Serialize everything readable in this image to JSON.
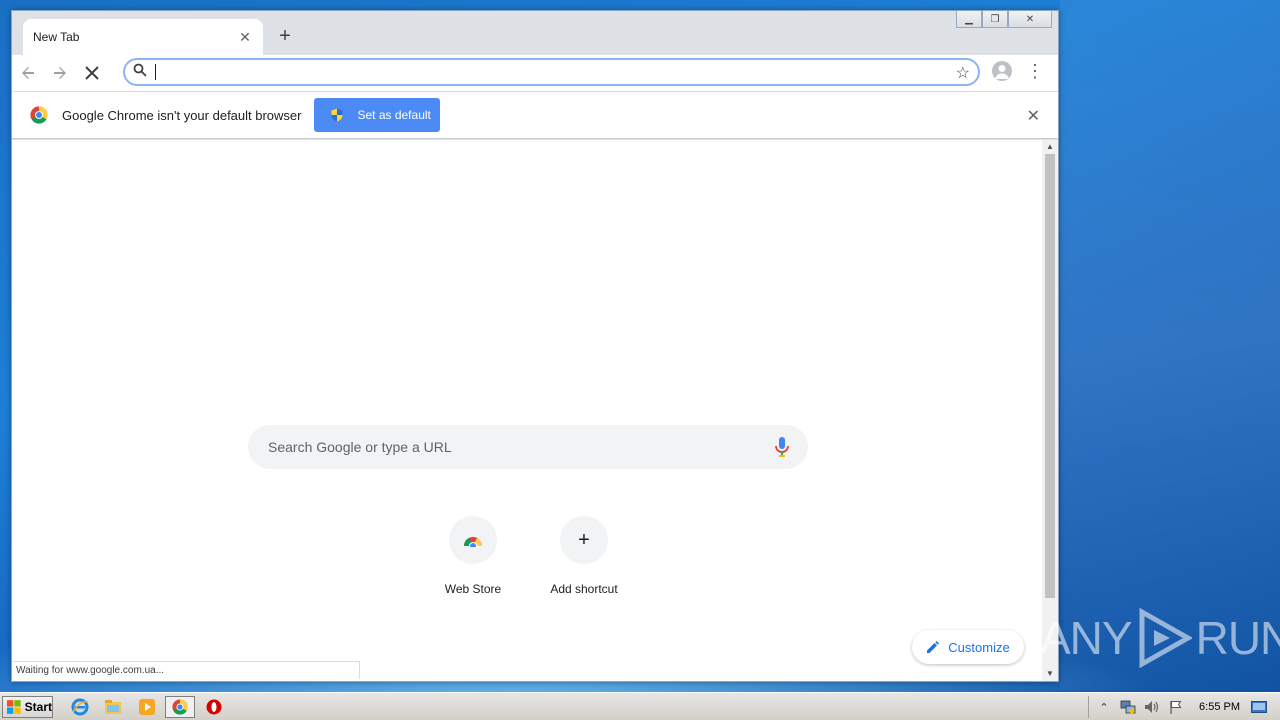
{
  "browser": {
    "tab_title": "New Tab",
    "omnibox_value": "",
    "infobar": {
      "message": "Google Chrome isn't your default browser",
      "button_label": "Set as default"
    },
    "status_text": "Waiting for www.google.com.ua..."
  },
  "ntp": {
    "search_placeholder": "Search Google or type a URL",
    "shortcuts": [
      {
        "label": "Web Store"
      },
      {
        "label": "Add shortcut"
      }
    ],
    "customize_label": "Customize"
  },
  "watermark": {
    "left": "ANY",
    "right": "RUN"
  },
  "taskbar": {
    "start_label": "Start",
    "clock": "6:55 PM"
  },
  "colors": {
    "accent": "#1a73e8",
    "infobar_button": "#4c8bf5"
  },
  "icons": [
    "search-icon",
    "star-icon",
    "profile-icon",
    "menu-icon",
    "back-icon",
    "forward-icon",
    "stop-icon",
    "mic-icon",
    "pencil-icon",
    "chrome-icon",
    "shield-icon"
  ]
}
